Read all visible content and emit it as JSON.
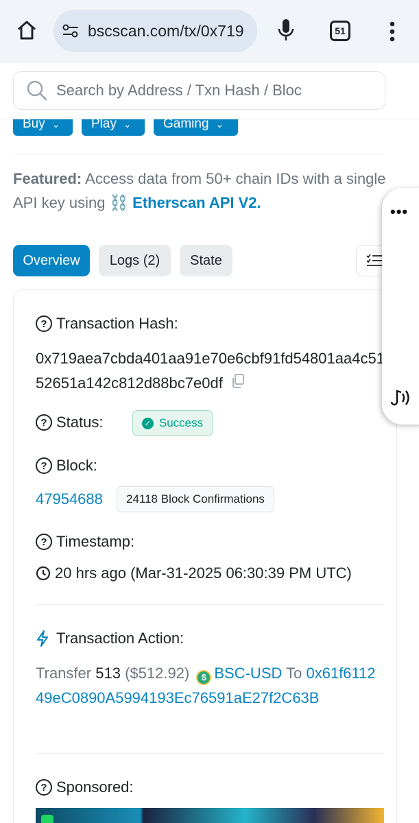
{
  "browser": {
    "url": "bscscan.com/tx/0x719",
    "tab_count": "51",
    "icons": [
      "home-icon",
      "site-settings-icon",
      "mic-icon",
      "tabs-icon",
      "more-vert-icon"
    ]
  },
  "search": {
    "placeholder": "Search by Address / Txn Hash / Bloc"
  },
  "nav_buttons": [
    {
      "label": "Buy"
    },
    {
      "label": "Play"
    },
    {
      "label": "Gaming"
    }
  ],
  "featured": {
    "prefix": "Featured:",
    "text": "Access data from 50+ chain IDs with a single API key using",
    "emoji": "⛓️",
    "link": "Etherscan API V2."
  },
  "tabs": [
    {
      "label": "Overview",
      "active": true
    },
    {
      "label": "Logs (2)",
      "active": false
    },
    {
      "label": "State",
      "active": false
    }
  ],
  "overview": {
    "hash_label": "Transaction Hash:",
    "hash_value": "0x719aea7cbda401aa91e70e6cbf91fd54801aa4c5152651a142c812d88bc7e0df",
    "status_label": "Status:",
    "status_value": "Success",
    "block_label": "Block:",
    "block_number": "47954688",
    "block_confirmations": "24118 Block Confirmations",
    "timestamp_label": "Timestamp:",
    "timestamp_value": "20 hrs ago (Mar-31-2025 06:30:39 PM UTC)",
    "action_label": "Transaction Action:",
    "action": {
      "verb": "Transfer",
      "amount": "513",
      "usd": "($512.92)",
      "token": "BSC-USD",
      "to_word": "To",
      "to_address": "0x61f611249eC0890A5994193Ec76591aE27f2C63B"
    },
    "sponsored_label": "Sponsored:"
  },
  "colors": {
    "accent": "#0784c3",
    "success": "#00a186",
    "muted": "#6c757d",
    "chrome_bg": "#f1f4f9",
    "urlbar_bg": "#dde6f1"
  }
}
